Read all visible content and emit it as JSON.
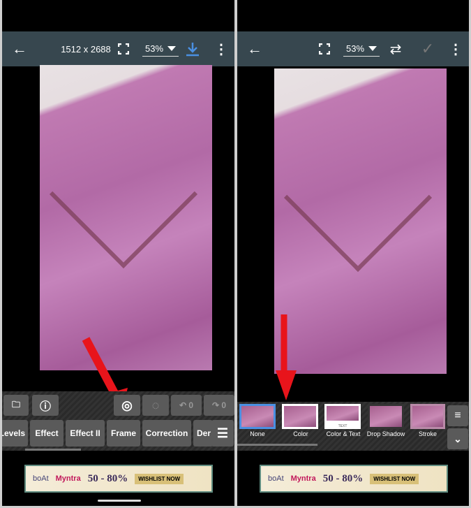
{
  "left": {
    "toolbar": {
      "back_icon": "arrow-left",
      "dimensions": "1512 x 2688",
      "fullscreen_icon": "fullscreen",
      "zoom": "53%",
      "download_icon": "download",
      "menu_icon": "more-vertical"
    },
    "tool_row": {
      "undo_count": "0",
      "redo_count": "0"
    },
    "tabs": [
      "Levels",
      "Effect",
      "Effect II",
      "Frame",
      "Correction",
      "Der"
    ],
    "ad": {
      "brand": "boAt",
      "store": "Myntra",
      "offer": "50 - 80%",
      "cta": "WISHLIST NOW"
    }
  },
  "right": {
    "toolbar": {
      "back_icon": "arrow-left",
      "fullscreen_icon": "fullscreen",
      "zoom": "53%",
      "swap_icon": "swap-horizontal",
      "apply_icon": "check",
      "menu_icon": "more-vertical"
    },
    "frames": [
      "None",
      "Color",
      "Color & Text",
      "Drop Shadow",
      "Stroke"
    ],
    "frame_text_sample": "TEXT",
    "ad": {
      "brand": "boAt",
      "store": "Myntra",
      "offer": "50 - 80%",
      "cta": "WISHLIST NOW"
    }
  },
  "colors": {
    "toolbar": "#37474f",
    "accent": "#4a90e2",
    "arrow": "#e8141b",
    "photo": "#b26aa6"
  }
}
